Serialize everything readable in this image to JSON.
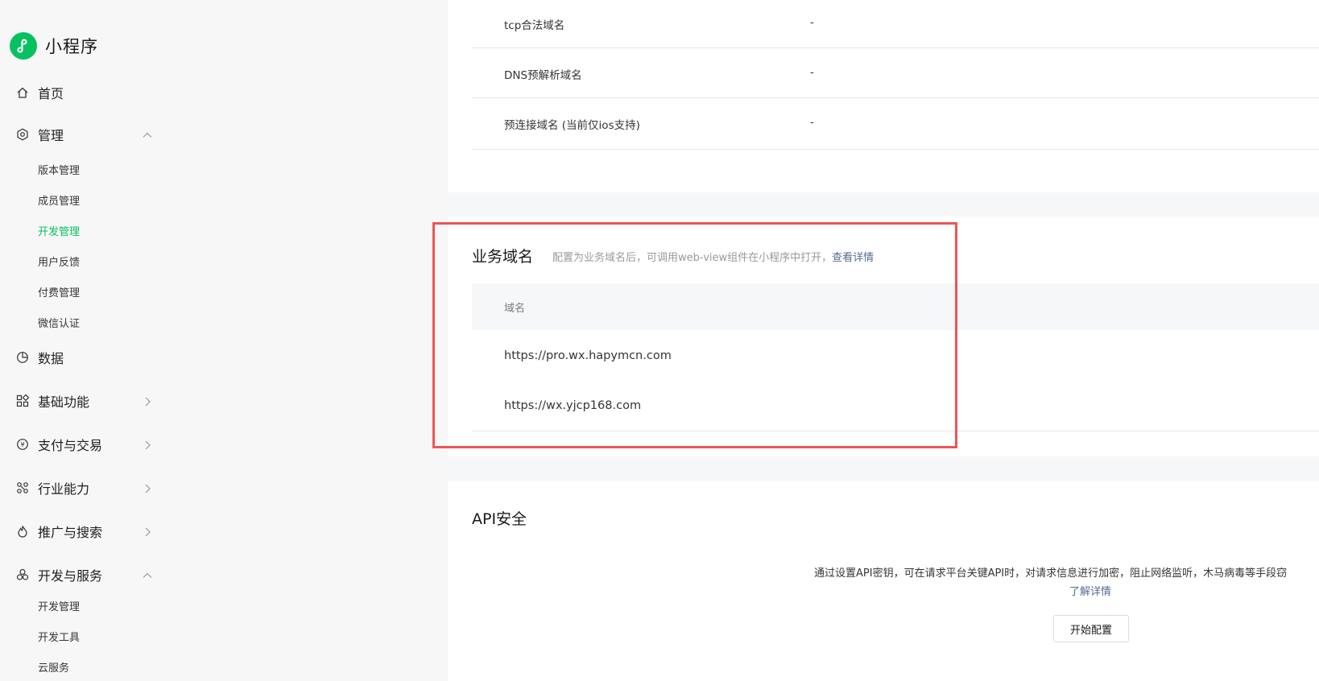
{
  "app": {
    "title": "小程序"
  },
  "colors": {
    "accent": "#07c160",
    "link": "#576b95",
    "highlight": "#f05454"
  },
  "sidebar": {
    "home": "首页",
    "manage": {
      "label": "管理",
      "children": [
        "版本管理",
        "成员管理",
        "开发管理",
        "用户反馈",
        "付费管理",
        "微信认证"
      ],
      "active": "开发管理"
    },
    "data": "数据",
    "basic": "基础功能",
    "pay": "支付与交易",
    "industry": "行业能力",
    "promo": "推广与搜索",
    "dev": {
      "label": "开发与服务",
      "children": [
        "开发管理",
        "开发工具",
        "云服务"
      ]
    }
  },
  "server_domains": {
    "rows": [
      {
        "key": "tcp合法域名",
        "value": "-"
      },
      {
        "key": "DNS预解析域名",
        "value": "-"
      },
      {
        "key": "预连接域名 (当前仅ios支持)",
        "value": "-"
      }
    ]
  },
  "business_domain": {
    "title": "业务域名",
    "desc": "配置为业务域名后，可调用web-view组件在小程序中打开，",
    "link": "查看详情",
    "column": "域名",
    "domains": [
      "https://pro.wx.hapymcn.com",
      "https://wx.yjcp168.com"
    ]
  },
  "api_security": {
    "title": "API安全",
    "desc": "通过设置API密钥，可在请求平台关键API时，对请求信息进行加密，阻止网络监听，木马病毒等手段窃",
    "link": "了解详情",
    "button": "开始配置"
  }
}
